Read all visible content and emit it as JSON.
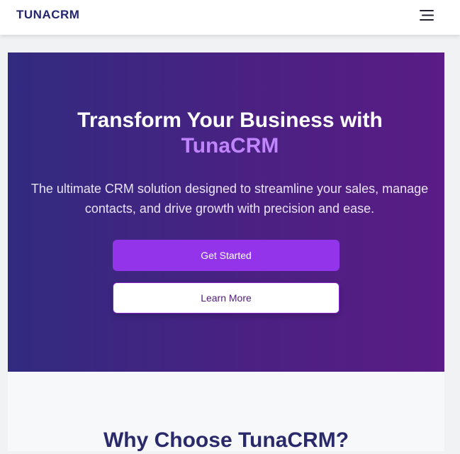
{
  "header": {
    "logo": "TUNACRM",
    "menu_icon": "hamburger-menu-icon"
  },
  "hero": {
    "title_line1": "Transform Your Business with",
    "title_highlight": "TunaCRM",
    "description": "The ultimate CRM solution designed to streamline your sales, manage contacts, and drive growth with precision and ease.",
    "primary_button": "Get Started",
    "secondary_button": "Learn More"
  },
  "features": {
    "title": "Why Choose TunaCRM?"
  },
  "colors": {
    "brand_dark": "#23256e",
    "hero_gradient_start": "#312b80",
    "hero_gradient_end": "#5a1c86",
    "accent": "#c084fc",
    "primary_button": "#9333ea"
  }
}
